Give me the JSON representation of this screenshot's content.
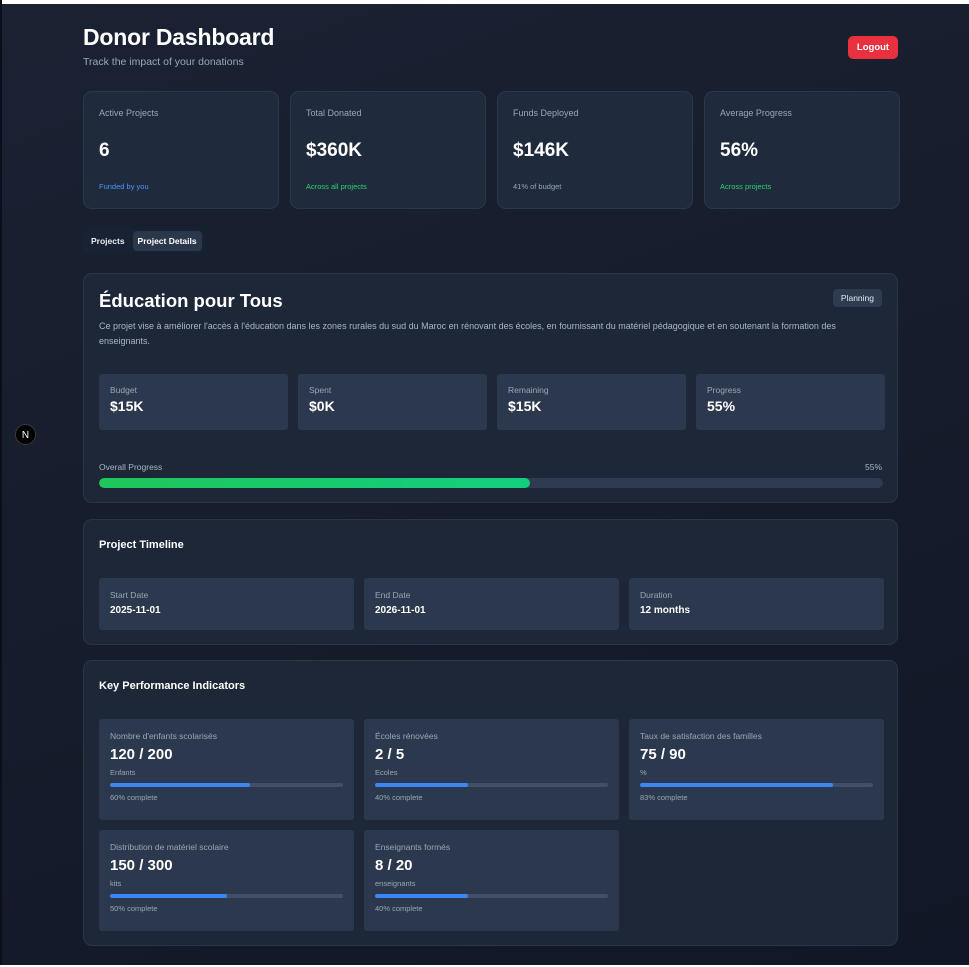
{
  "header": {
    "title": "Donor Dashboard",
    "subtitle": "Track the impact of your donations",
    "logout_label": "Logout"
  },
  "stats": [
    {
      "label": "Active Projects",
      "value": "6",
      "note": "Funded by you",
      "note_color": "#4b94ff"
    },
    {
      "label": "Total Donated",
      "value": "$360K",
      "note": "Across all projects",
      "note_color": "#2fd36f"
    },
    {
      "label": "Funds Deployed",
      "value": "$146K",
      "note": "41% of budget",
      "note_color": "#9aa7bb"
    },
    {
      "label": "Average Progress",
      "value": "56%",
      "note": "Across projects",
      "note_color": "#2fd36f"
    }
  ],
  "tabs": [
    {
      "label": "Projects",
      "active": false
    },
    {
      "label": "Project Details",
      "active": true
    }
  ],
  "project": {
    "title": "Éducation pour Tous",
    "status": "Planning",
    "description": "Ce projet vise à améliorer l'accès à l'éducation dans les zones rurales du sud du Maroc en rénovant des écoles, en fournissant du matériel pédagogique et en soutenant la formation des enseignants.",
    "metrics": [
      {
        "label": "Budget",
        "value": "$15K"
      },
      {
        "label": "Spent",
        "value": "$0K"
      },
      {
        "label": "Remaining",
        "value": "$15K"
      },
      {
        "label": "Progress",
        "value": "55%"
      }
    ],
    "overall_progress_label": "Overall Progress",
    "overall_progress_text": "55%",
    "overall_progress": 55
  },
  "timeline": {
    "title": "Project Timeline",
    "items": [
      {
        "label": "Start Date",
        "value": "2025-11-01"
      },
      {
        "label": "End Date",
        "value": "2026-11-01"
      },
      {
        "label": "Duration",
        "value": "12 months"
      }
    ]
  },
  "kpis": {
    "title": "Key Performance Indicators",
    "items": [
      {
        "label": "Nombre d'enfants scolarisés",
        "value": "120 / 200",
        "unit": "Enfants",
        "percent": 60,
        "complete": "60% complete"
      },
      {
        "label": "Écoles rénovées",
        "value": "2 / 5",
        "unit": "Ecoles",
        "percent": 40,
        "complete": "40% complete"
      },
      {
        "label": "Taux de satisfaction des familles",
        "value": "75 / 90",
        "unit": "%",
        "percent": 83,
        "complete": "83% complete"
      },
      {
        "label": "Distribution de matériel scolaire",
        "value": "150 / 300",
        "unit": "kits",
        "percent": 50,
        "complete": "50% complete"
      },
      {
        "label": "Enseignants formés",
        "value": "8 / 20",
        "unit": "enseignants",
        "percent": 40,
        "complete": "40% complete"
      }
    ]
  },
  "dev_badge": {
    "letter": "N",
    "icon": "nextjs-icon"
  }
}
